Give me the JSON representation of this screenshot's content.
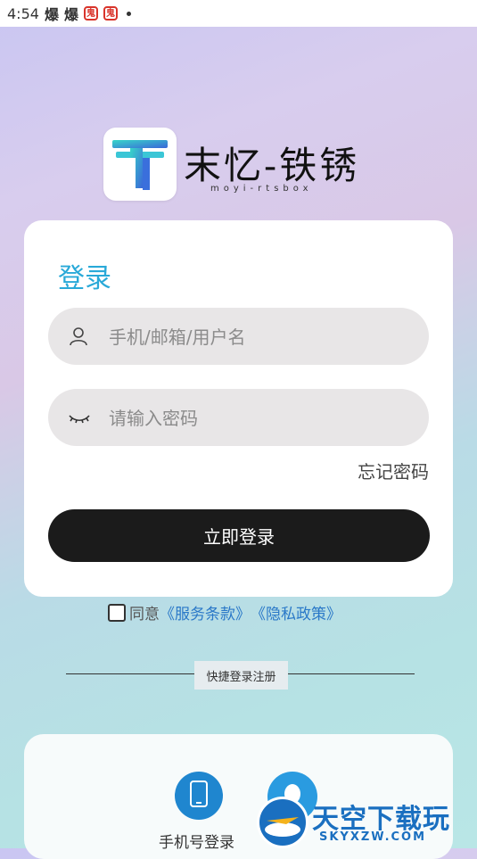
{
  "status_bar": {
    "time": "4:54",
    "icon1": "爆",
    "icon2": "爆",
    "icon3": "鬼",
    "icon4": "鬼"
  },
  "logo": {
    "title": "末忆-铁锈",
    "subtitle": "moyi-rtsbox"
  },
  "login": {
    "title": "登录",
    "username_placeholder": "手机/邮箱/用户名",
    "password_placeholder": "请输入密码",
    "forgot": "忘记密码",
    "button": "立即登录"
  },
  "agreement": {
    "prefix": "同意",
    "terms": "《服务条款》",
    "privacy": "《隐私政策》"
  },
  "quick_login": {
    "divider_label": "快捷登录注册",
    "phone_label": "手机号登录"
  },
  "watermark": {
    "big": "天空下载玩",
    "small": "SKYXZW.COM"
  },
  "colors": {
    "accent": "#29a9d8",
    "button": "#1b1b1b",
    "link": "#2a78c8"
  }
}
